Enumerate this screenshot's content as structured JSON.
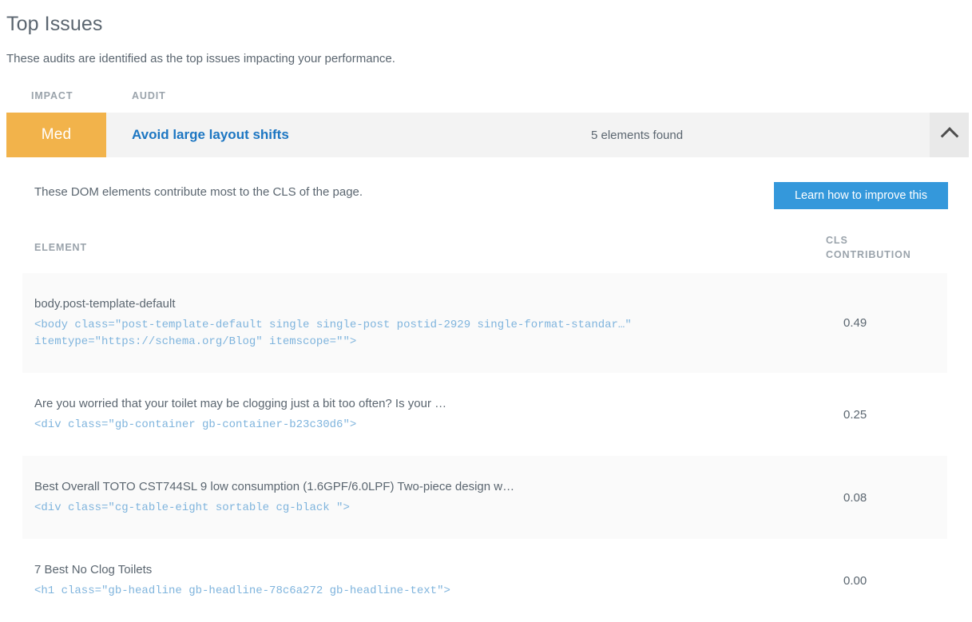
{
  "header": {
    "title": "Top Issues",
    "subtitle": "These audits are identified as the top issues impacting your performance."
  },
  "audit_table": {
    "columns": {
      "impact": "IMPACT",
      "audit": "AUDIT"
    },
    "row": {
      "impact_label": "Med",
      "impact_color": "#f2b34b",
      "audit_name": "Avoid large layout shifts",
      "audit_name_color": "#1c76c2",
      "elements_found": "5 elements found",
      "toggle_icon": "chevron-up-icon",
      "expanded": true
    }
  },
  "panel": {
    "description": "These DOM elements contribute most to the CLS of the page.",
    "learn_button": "Learn how to improve this",
    "learn_button_color": "#3498db",
    "columns": {
      "element": "ELEMENT",
      "cls": "CLS CONTRIBUTION",
      "cls_line1": "CLS",
      "cls_line2": "CONTRIBUTION"
    },
    "rows": [
      {
        "label": "body.post-template-default",
        "code": "<body class=\"post-template-default single single-post postid-2929 single-format-standar…\" itemtype=\"https://schema.org/Blog\" itemscope=\"\">",
        "cls": "0.49"
      },
      {
        "label": "Are you worried that your toilet may be clogging just a bit too often? Is your …",
        "code": "<div class=\"gb-container gb-container-b23c30d6\">",
        "cls": "0.25"
      },
      {
        "label": "Best Overall TOTO CST744SL 9 low consumption (1.6GPF/6.0LPF) Two-piece design w…",
        "code": "<div class=\"cg-table-eight sortable cg-black \">",
        "cls": "0.08"
      },
      {
        "label": "7 Best No Clog Toilets",
        "code": "<h1 class=\"gb-headline gb-headline-78c6a272 gb-headline-text\">",
        "cls": "0.00"
      }
    ]
  }
}
